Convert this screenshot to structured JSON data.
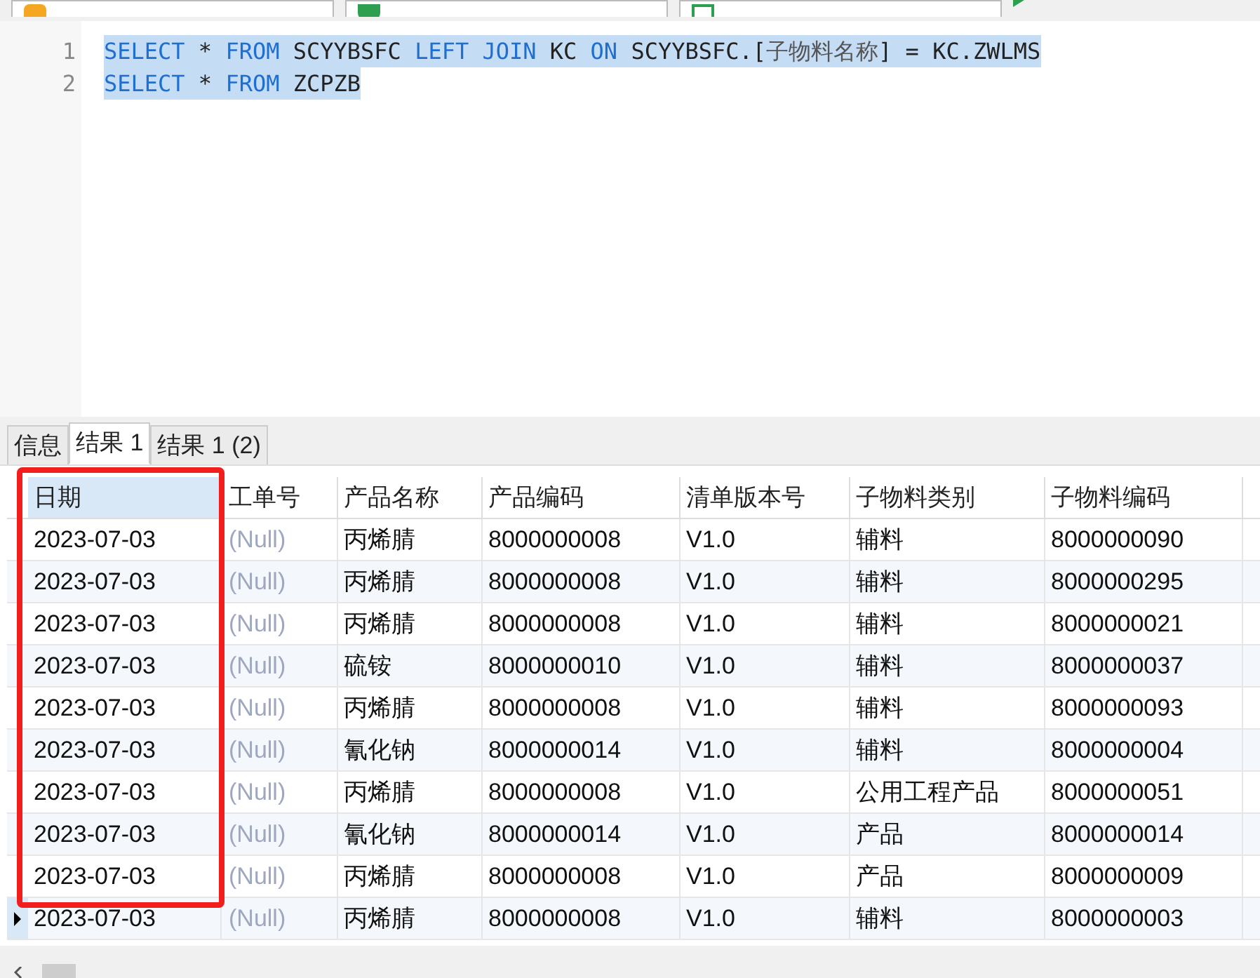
{
  "toolbar": {
    "dropdowns": [
      {
        "kind": "connection"
      },
      {
        "kind": "database"
      },
      {
        "kind": "schema"
      }
    ],
    "run_button": {
      "kind": "run"
    }
  },
  "editor": {
    "lines": [
      {
        "number": "1",
        "tokens": [
          {
            "kind": "keyword",
            "text": "SELECT"
          },
          {
            "kind": "plain",
            "text": " * "
          },
          {
            "kind": "keyword",
            "text": "FROM"
          },
          {
            "kind": "plain",
            "text": " SCYYBSFC "
          },
          {
            "kind": "keyword",
            "text": "LEFT JOIN"
          },
          {
            "kind": "plain",
            "text": " KC "
          },
          {
            "kind": "keyword",
            "text": "ON"
          },
          {
            "kind": "plain",
            "text": " SCYYBSFC.["
          },
          {
            "kind": "cjk",
            "text": "子物料名称"
          },
          {
            "kind": "plain",
            "text": "] = KC.ZWLMS"
          }
        ],
        "selected": true
      },
      {
        "number": "2",
        "tokens": [
          {
            "kind": "keyword",
            "text": "SELECT"
          },
          {
            "kind": "plain",
            "text": " * "
          },
          {
            "kind": "keyword",
            "text": "FROM"
          },
          {
            "kind": "plain",
            "text": " ZCPZB"
          }
        ],
        "selected": true
      }
    ]
  },
  "tabs": [
    {
      "label": "信息",
      "selected": false
    },
    {
      "label": "结果 1",
      "selected": true
    },
    {
      "label": "结果 1 (2)",
      "selected": false
    }
  ],
  "table": {
    "columns": [
      {
        "label": "日期",
        "selected": true
      },
      {
        "label": "工单号",
        "selected": false
      },
      {
        "label": "产品名称",
        "selected": false
      },
      {
        "label": "产品编码",
        "selected": false
      },
      {
        "label": "清单版本号",
        "selected": false
      },
      {
        "label": "子物料类别",
        "selected": false
      },
      {
        "label": "子物料编码",
        "selected": false
      }
    ],
    "rows": [
      {
        "selected": false,
        "cells": [
          "2023-07-03",
          "(Null)",
          "丙烯腈",
          "8000000008",
          "V1.0",
          "辅料",
          "8000000090"
        ]
      },
      {
        "selected": false,
        "cells": [
          "2023-07-03",
          "(Null)",
          "丙烯腈",
          "8000000008",
          "V1.0",
          "辅料",
          "8000000295"
        ]
      },
      {
        "selected": false,
        "cells": [
          "2023-07-03",
          "(Null)",
          "丙烯腈",
          "8000000008",
          "V1.0",
          "辅料",
          "8000000021"
        ]
      },
      {
        "selected": false,
        "cells": [
          "2023-07-03",
          "(Null)",
          "硫铵",
          "8000000010",
          "V1.0",
          "辅料",
          "8000000037"
        ]
      },
      {
        "selected": false,
        "cells": [
          "2023-07-03",
          "(Null)",
          "丙烯腈",
          "8000000008",
          "V1.0",
          "辅料",
          "8000000093"
        ]
      },
      {
        "selected": false,
        "cells": [
          "2023-07-03",
          "(Null)",
          "氰化钠",
          "8000000014",
          "V1.0",
          "辅料",
          "8000000004"
        ]
      },
      {
        "selected": false,
        "cells": [
          "2023-07-03",
          "(Null)",
          "丙烯腈",
          "8000000008",
          "V1.0",
          "公用工程产品",
          "8000000051"
        ]
      },
      {
        "selected": false,
        "cells": [
          "2023-07-03",
          "(Null)",
          "氰化钠",
          "8000000014",
          "V1.0",
          "产品",
          "8000000014"
        ]
      },
      {
        "selected": false,
        "cells": [
          "2023-07-03",
          "(Null)",
          "丙烯腈",
          "8000000008",
          "V1.0",
          "产品",
          "8000000009"
        ]
      },
      {
        "selected": true,
        "cells": [
          "2023-07-03",
          "(Null)",
          "丙烯腈",
          "8000000008",
          "V1.0",
          "辅料",
          "8000000003"
        ]
      }
    ]
  }
}
